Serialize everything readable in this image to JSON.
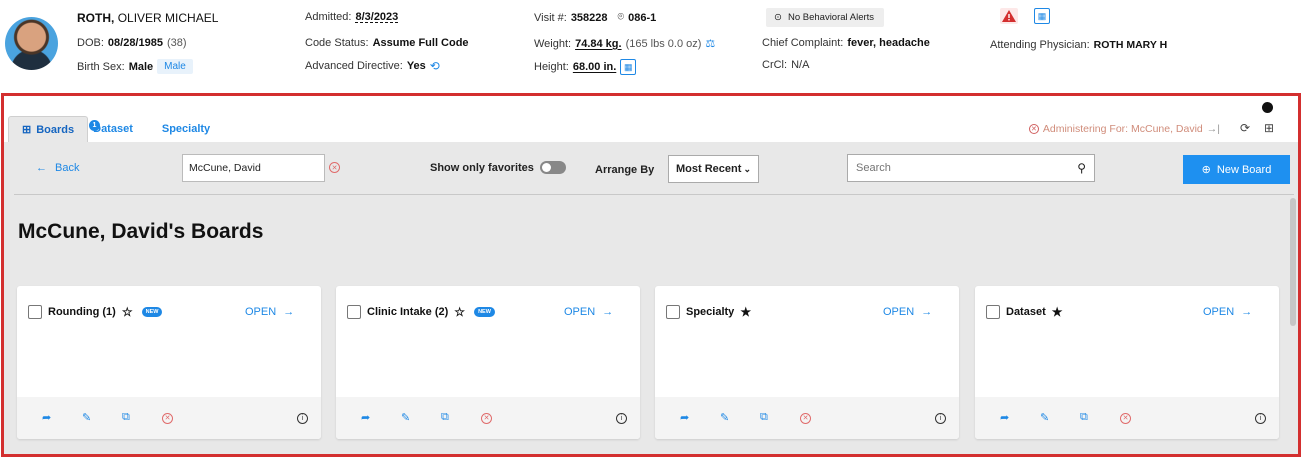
{
  "patient": {
    "last_name": "ROTH,",
    "first_names": "OLIVER MICHAEL",
    "dob_label": "DOB:",
    "dob": "08/28/1985",
    "age": "(38)",
    "birth_sex_label": "Birth Sex:",
    "birth_sex": "Male",
    "gender_chip": "Male",
    "admitted_label": "Admitted:",
    "admitted": "8/3/2023",
    "code_status_label": "Code Status:",
    "code_status": "Assume Full Code",
    "advanced_directive_label": "Advanced Directive:",
    "advanced_directive": "Yes",
    "visit_label": "Visit #:",
    "visit": "358228",
    "room": "086-1",
    "weight_label": "Weight:",
    "weight": "74.84 kg.",
    "weight_lbs": "(165 lbs 0.0 oz)",
    "height_label": "Height:",
    "height": "68.00 in.",
    "behavioral": "No Behavioral Alerts",
    "chief_complaint_label": "Chief Complaint:",
    "chief_complaint": "fever, headache",
    "crcl_label": "CrCl:",
    "crcl": "N/A",
    "attending_label": "Attending Physician:",
    "attending": "ROTH MARY H"
  },
  "tabs": [
    {
      "label": "Boards",
      "badge": "1"
    },
    {
      "label": "Dataset"
    },
    {
      "label": "Specialty"
    }
  ],
  "administering": "Administering For: McCune, David",
  "toolbar": {
    "back": "Back",
    "patient_value": "McCune, David",
    "favorites_label": "Show only favorites",
    "arrange_label": "Arrange By",
    "arrange_value": "Most Recent",
    "search_placeholder": "Search",
    "new_board": "New Board"
  },
  "heading": "McCune, David's Boards",
  "boards": [
    {
      "title": "Rounding (1)",
      "starred": false,
      "new_badge": "NEW",
      "open": "OPEN"
    },
    {
      "title": "Clinic Intake (2)",
      "starred": false,
      "new_badge": "NEW",
      "open": "OPEN"
    },
    {
      "title": "Specialty",
      "starred": true,
      "open": "OPEN"
    },
    {
      "title": "Dataset",
      "starred": true,
      "open": "OPEN"
    }
  ],
  "colors": {
    "accent": "#1e88e5",
    "frame": "#d32f2f",
    "danger": "#e06b6b"
  }
}
